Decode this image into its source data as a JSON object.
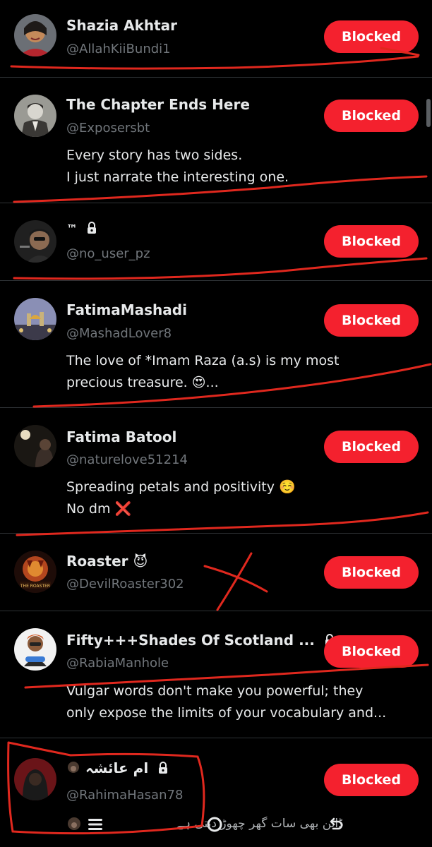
{
  "button_label": "Blocked",
  "accent_color": "#f4212e",
  "rows": [
    {
      "name": "Shazia Akhtar",
      "handle": "@AllahKiiBundi1",
      "bio": []
    },
    {
      "name": "The Chapter Ends Here",
      "handle": "@Exposersbt",
      "bio": [
        "Every story has two sides.",
        "I just narrate the interesting one."
      ]
    },
    {
      "name": "™",
      "handle": "@no_user_pz",
      "bio": [],
      "locked": true
    },
    {
      "name": "FatimaMashadi",
      "handle": "@MashadLover8",
      "bio": [
        "The love of *Imam Raza (a.s)  is my most",
        "precious treasure. 😍..."
      ]
    },
    {
      "name": "Fatima Batool",
      "handle": "@naturelove51214",
      "bio": [
        "Spreading petals and positivity ☺️",
        "No dm ❌"
      ]
    },
    {
      "name": "Roaster 😈",
      "handle": "@DevilRoaster302",
      "bio": []
    },
    {
      "name": "Fifty+++Shades Of Scotland ...",
      "handle": "@RabiaManhole",
      "bio": [
        "Vulgar words don't make you powerful; they",
        "only expose the limits of your vocabulary and..."
      ],
      "locked": true
    },
    {
      "name": "ام عائشہ",
      "handle": "@RahimaHasan78",
      "bio": [],
      "locked": true
    }
  ],
  "avatar_labels": {
    "roaster": "THE ROASTER"
  },
  "bottom_bar": {
    "text": "ڈائن بھی سات گھر چھوڑ دیتی ہے"
  }
}
